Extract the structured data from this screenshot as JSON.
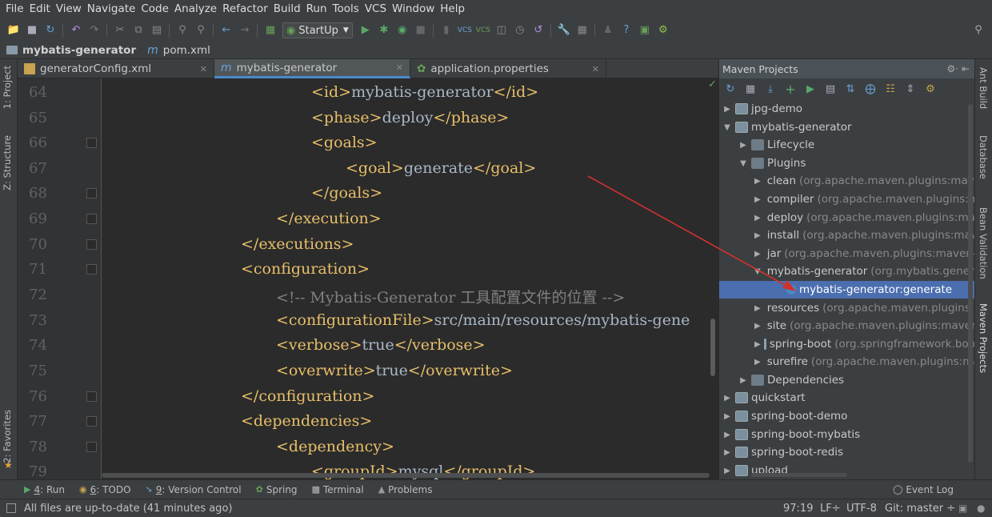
{
  "menu": [
    "File",
    "Edit",
    "View",
    "Navigate",
    "Code",
    "Analyze",
    "Refactor",
    "Build",
    "Run",
    "Tools",
    "VCS",
    "Window",
    "Help"
  ],
  "toolbar": {
    "run_config": "StartUp"
  },
  "navbar": {
    "project": "mybatis-generator",
    "file": "pom.xml"
  },
  "left_strip": {
    "project": "1: Project",
    "structure": "Z: Structure",
    "favorites": "2: Favorites"
  },
  "right_strip": {
    "ant": "Ant Build",
    "database": "Database",
    "bean": "Bean Validation",
    "maven": "Maven Projects"
  },
  "tabs": [
    {
      "label": "generatorConfig.xml"
    },
    {
      "label": "mybatis-generator"
    },
    {
      "label": "application.properties"
    }
  ],
  "editor": {
    "line_numbers": [
      "64",
      "65",
      "66",
      "67",
      "68",
      "69",
      "70",
      "71",
      "72",
      "73",
      "74",
      "75",
      "76",
      "77",
      "78",
      "79"
    ],
    "lines": [
      {
        "open": "<id>",
        "text": "mybatis-generator",
        "close": "</id>"
      },
      {
        "open": "<phase>",
        "text": "deploy",
        "close": "</phase>"
      },
      {
        "open": "<goals>",
        "text": "",
        "close": ""
      },
      {
        "open": "<goal>",
        "text": "generate",
        "close": "</goal>"
      },
      {
        "open": "</goals>",
        "text": "",
        "close": ""
      },
      {
        "open": "</execution>",
        "text": "",
        "close": ""
      },
      {
        "open": "</executions>",
        "text": "",
        "close": ""
      },
      {
        "open": "<configuration>",
        "text": "",
        "close": ""
      },
      {
        "comment": "<!-- Mybatis-Generator 工具配置文件的位置 -->"
      },
      {
        "open": "<configurationFile>",
        "text": "src/main/resources/mybatis-gene",
        "close": ""
      },
      {
        "open": "<verbose>",
        "text": "true",
        "close": "</verbose>"
      },
      {
        "open": "<overwrite>",
        "text": "true",
        "close": "</overwrite>"
      },
      {
        "open": "</configuration>",
        "text": "",
        "close": ""
      },
      {
        "open": "<dependencies>",
        "text": "",
        "close": ""
      },
      {
        "open": "<dependency>",
        "text": "",
        "close": ""
      },
      {
        "open": "<groupId>",
        "text": "mysql",
        "close": "</groupId>"
      }
    ]
  },
  "maven": {
    "title": "Maven Projects",
    "tree": [
      {
        "label": "jpg-demo",
        "detail": ""
      },
      {
        "label": "mybatis-generator",
        "detail": ""
      },
      {
        "label": "Lifecycle",
        "detail": ""
      },
      {
        "label": "Plugins",
        "detail": ""
      },
      {
        "label": "clean",
        "detail": "(org.apache.maven.plugins:mave"
      },
      {
        "label": "compiler",
        "detail": "(org.apache.maven.plugins:m"
      },
      {
        "label": "deploy",
        "detail": "(org.apache.maven.plugins:mav"
      },
      {
        "label": "install",
        "detail": "(org.apache.maven.plugins:mave"
      },
      {
        "label": "jar",
        "detail": "(org.apache.maven.plugins:maven-j"
      },
      {
        "label": "mybatis-generator",
        "detail": "(org.mybatis.genera"
      },
      {
        "label": "mybatis-generator:generate",
        "detail": ""
      },
      {
        "label": "resources",
        "detail": "(org.apache.maven.plugins:m"
      },
      {
        "label": "site",
        "detail": "(org.apache.maven.plugins:maven-"
      },
      {
        "label": "spring-boot",
        "detail": "(org.springframework.boo"
      },
      {
        "label": "surefire",
        "detail": "(org.apache.maven.plugins:ma"
      },
      {
        "label": "Dependencies",
        "detail": ""
      },
      {
        "label": "quickstart",
        "detail": ""
      },
      {
        "label": "spring-boot-demo",
        "detail": ""
      },
      {
        "label": "spring-boot-mybatis",
        "detail": ""
      },
      {
        "label": "spring-boot-redis",
        "detail": ""
      },
      {
        "label": "upload",
        "detail": ""
      }
    ]
  },
  "bottom_tabs": [
    {
      "key": "4",
      "label": ": Run"
    },
    {
      "key": "6",
      "label": ": TODO"
    },
    {
      "key": "9",
      "label": ": Version Control"
    },
    {
      "key": "",
      "label": "Spring"
    },
    {
      "key": "",
      "label": "Terminal"
    },
    {
      "key": "",
      "label": "Problems"
    }
  ],
  "event_log": "Event Log",
  "status": {
    "message": "All files are up-to-date (41 minutes ago)",
    "position": "97:19",
    "line_sep": "LF÷",
    "encoding": "UTF-8",
    "git": "Git: master ÷"
  },
  "colors": {
    "accent": "#4a88c7",
    "selection": "#4b6eaf",
    "tag": "#e8bf6a",
    "arrow": "#d0312d"
  }
}
